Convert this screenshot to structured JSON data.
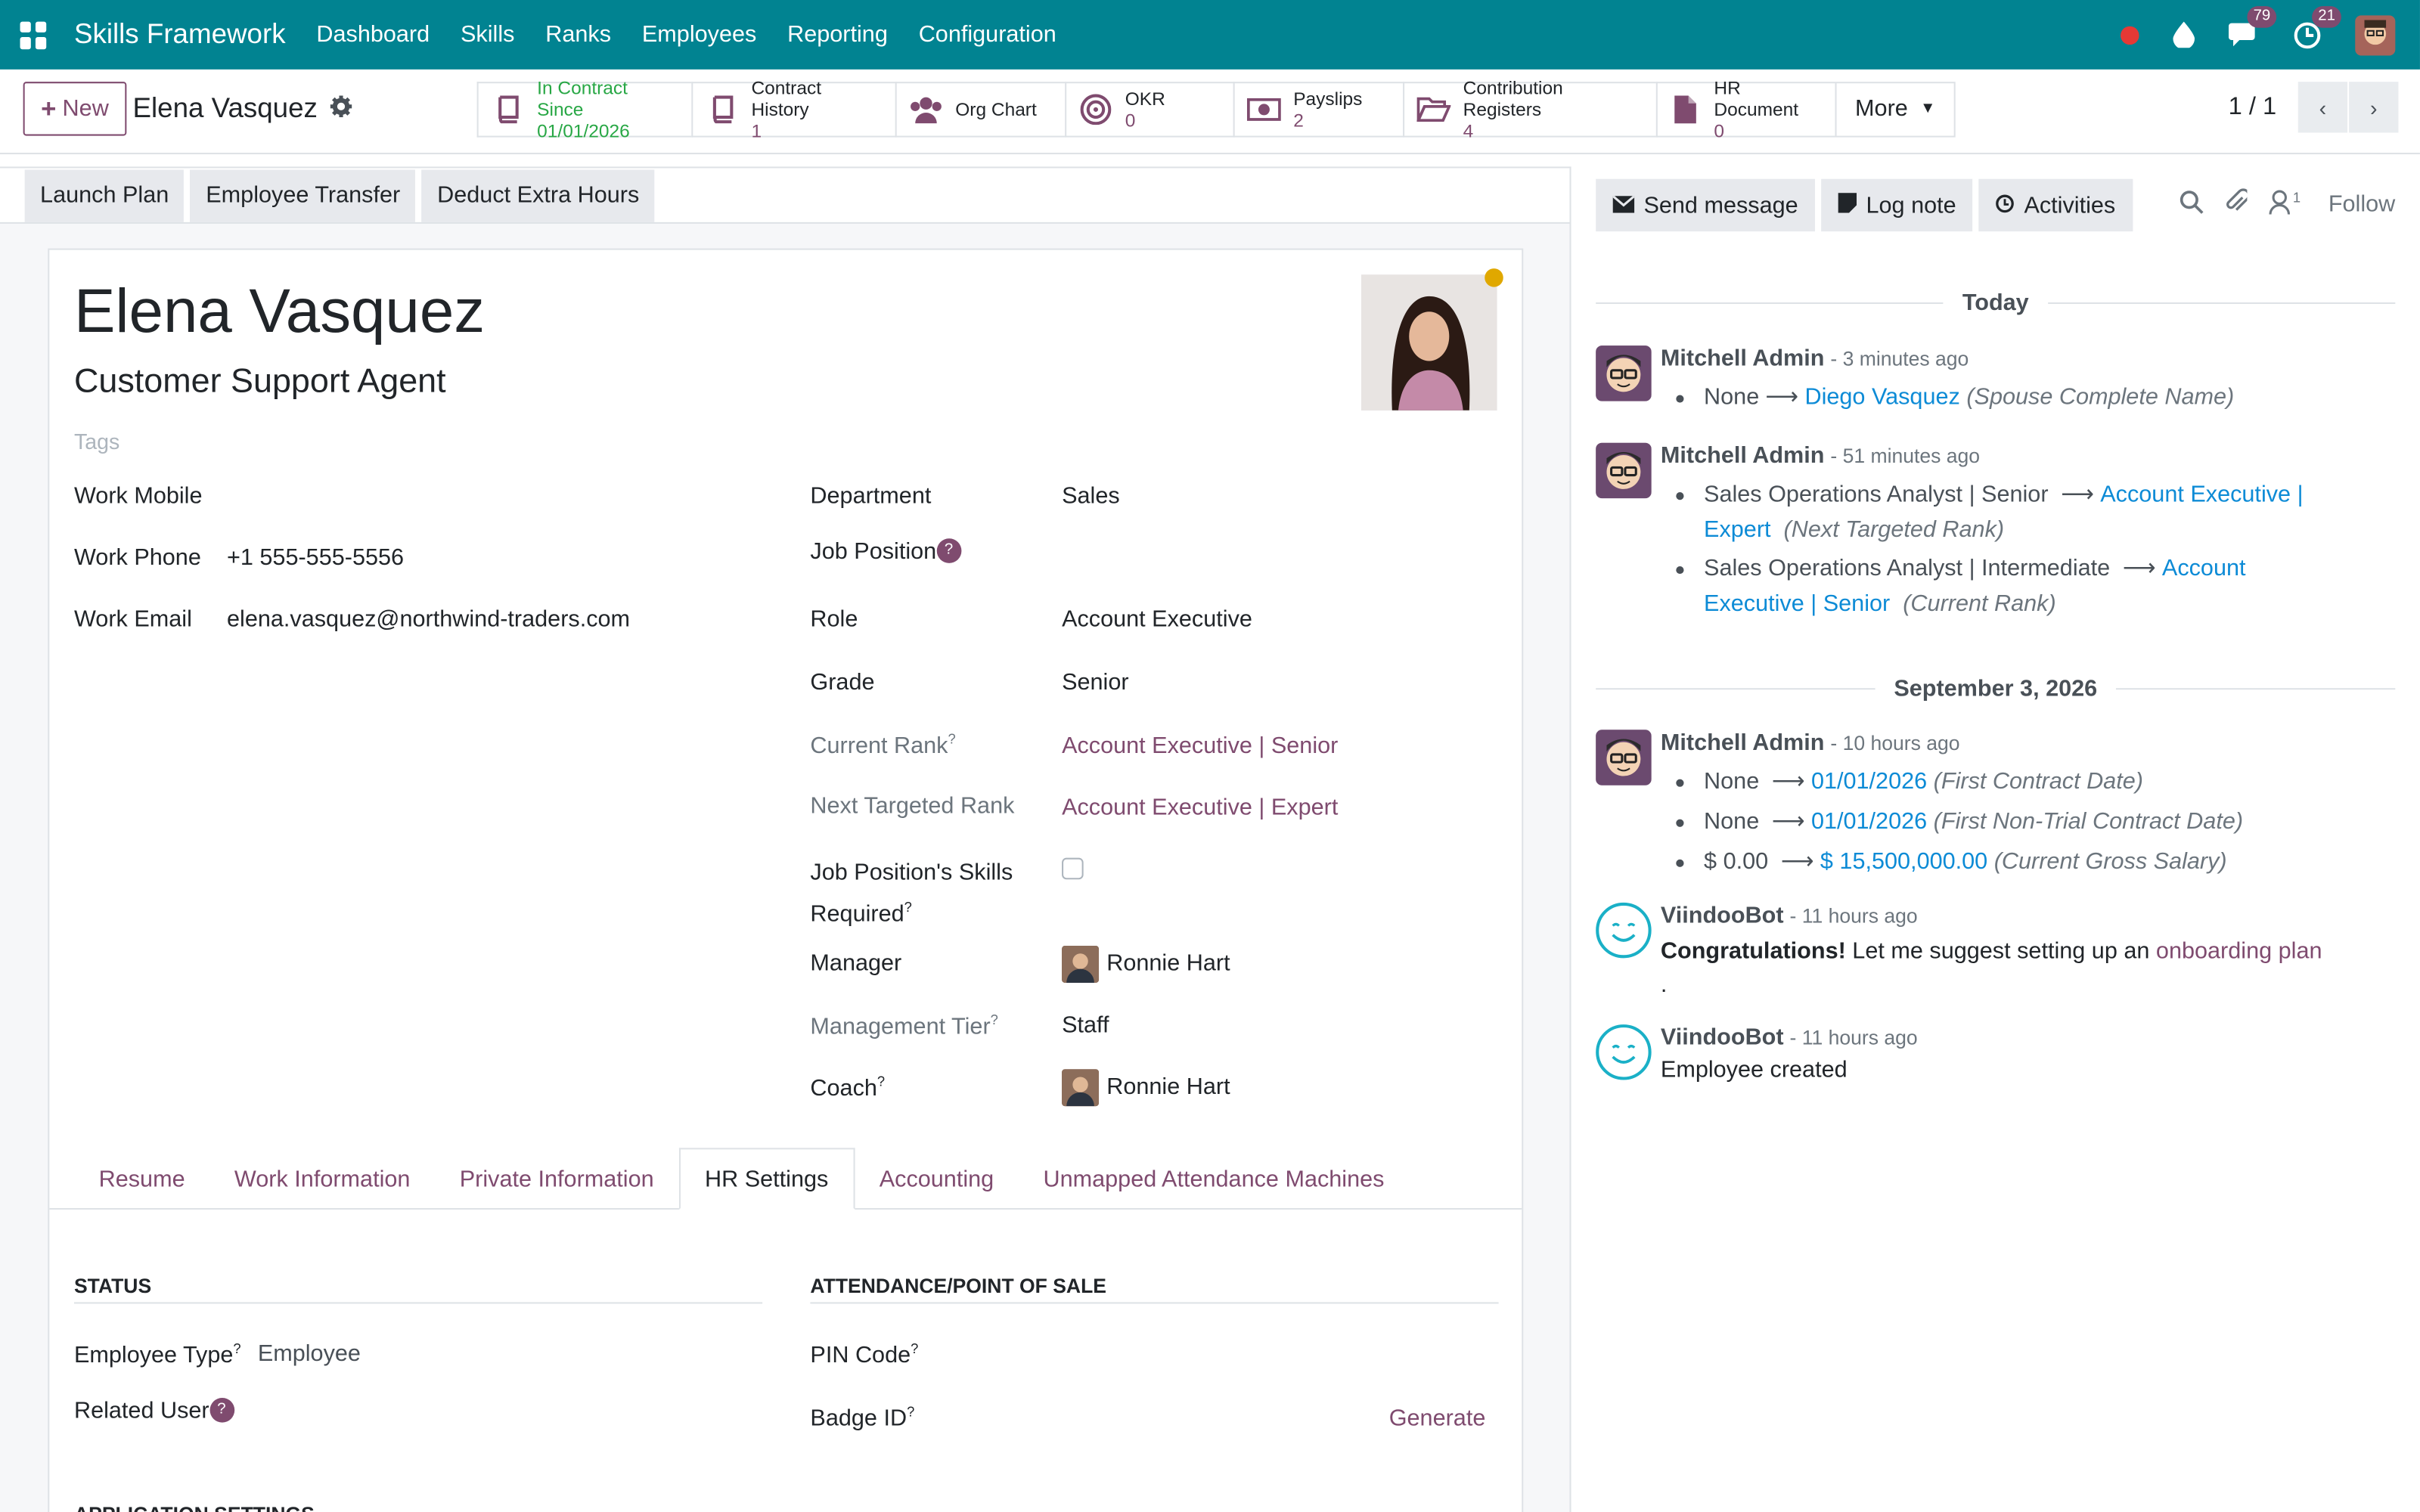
{
  "topnav": {
    "brand": "Skills Framework",
    "menu": [
      "Dashboard",
      "Skills",
      "Ranks",
      "Employees",
      "Reporting",
      "Configuration"
    ],
    "messages_count": "79",
    "activities_count": "21"
  },
  "controlbar": {
    "new_label": "New",
    "breadcrumb": "Elena Vasquez",
    "stat_buttons": [
      {
        "label": "In Contract Since",
        "value": "01/01/2026"
      },
      {
        "label": "Contract History",
        "value": "1"
      },
      {
        "label": "Org Chart",
        "value": ""
      },
      {
        "label": "OKR",
        "value": "0"
      },
      {
        "label": "Payslips",
        "value": "2"
      },
      {
        "label": "Contribution Registers",
        "value": "4"
      },
      {
        "label": "HR Document",
        "value": "0"
      }
    ],
    "more_label": "More",
    "pager": "1 / 1"
  },
  "header_actions": [
    "Launch Plan",
    "Employee Transfer",
    "Deduct Extra Hours"
  ],
  "employee": {
    "name": "Elena Vasquez",
    "job_title": "Customer Support Agent",
    "tags_placeholder": "Tags",
    "work_mobile_label": "Work Mobile",
    "work_mobile": "",
    "work_phone_label": "Work Phone",
    "work_phone": "+1 555-555-5556",
    "work_email_label": "Work Email",
    "work_email": "elena.vasquez@northwind-traders.com",
    "department_label": "Department",
    "department": "Sales",
    "job_position_label": "Job Position",
    "role_label": "Role",
    "role": "Account Executive",
    "grade_label": "Grade",
    "grade": "Senior",
    "current_rank_label": "Current Rank",
    "current_rank": "Account Executive | Senior",
    "next_rank_label": "Next Targeted Rank",
    "next_rank": "Account Executive | Expert",
    "skills_required_label_1": "Job Position's Skills",
    "skills_required_label_2": "Required",
    "manager_label": "Manager",
    "manager": "Ronnie Hart",
    "management_tier_label": "Management Tier",
    "management_tier": "Staff",
    "coach_label": "Coach",
    "coach": "Ronnie Hart"
  },
  "tabs": [
    "Resume",
    "Work Information",
    "Private Information",
    "HR Settings",
    "Accounting",
    "Unmapped Attendance Machines"
  ],
  "hr_settings": {
    "status_title": "STATUS",
    "attendance_title": "ATTENDANCE/POINT OF SALE",
    "employee_type_label": "Employee Type",
    "employee_type": "Employee",
    "related_user_label": "Related User",
    "pin_code_label": "PIN Code",
    "badge_id_label": "Badge ID",
    "generate_label": "Generate",
    "app_settings_title": "APPLICATION SETTINGS"
  },
  "chatter": {
    "send_message": "Send message",
    "log_note": "Log note",
    "activities": "Activities",
    "follow": "Follow",
    "followers_count": "1",
    "date_today": "Today",
    "date_2": "September 3, 2026",
    "messages": [
      {
        "author": "Mitchell Admin",
        "ago": "- 3 minutes ago",
        "changes": [
          {
            "old": "None",
            "new": "Diego Vasquez",
            "field": "(Spouse Complete Name)"
          }
        ]
      },
      {
        "author": "Mitchell Admin",
        "ago": "- 51 minutes ago",
        "changes": [
          {
            "old": "Sales Operations Analyst | Senior",
            "new_1": "Account Executive |",
            "new_2": "Expert",
            "field": "(Next Targeted Rank)"
          },
          {
            "old": "Sales Operations Analyst | Intermediate",
            "new_1": "Account",
            "new_2": "Executive | Senior",
            "field": "(Current Rank)"
          }
        ]
      },
      {
        "author": "Mitchell Admin",
        "ago": "- 10 hours ago",
        "changes": [
          {
            "old": "None",
            "new": "01/01/2026",
            "field": "(First Contract Date)"
          },
          {
            "old": "None",
            "new": "01/01/2026",
            "field": "(First Non-Trial Contract Date)"
          },
          {
            "old": "$ 0.00",
            "new": "$ 15,500,000.00",
            "field": "(Current Gross Salary)"
          }
        ]
      },
      {
        "author": "ViindooBot",
        "ago": "- 11 hours ago",
        "bold": "Congratulations!",
        "text": " Let me suggest setting up an ",
        "link": "onboarding plan",
        "tail": "."
      },
      {
        "author": "ViindooBot",
        "ago": "- 11 hours ago",
        "text": "Employee created"
      }
    ]
  },
  "colors": {
    "nav": "#018391",
    "accent": "#7f4b6f",
    "link_blue": "#0d8bd6",
    "green": "#28a745"
  }
}
